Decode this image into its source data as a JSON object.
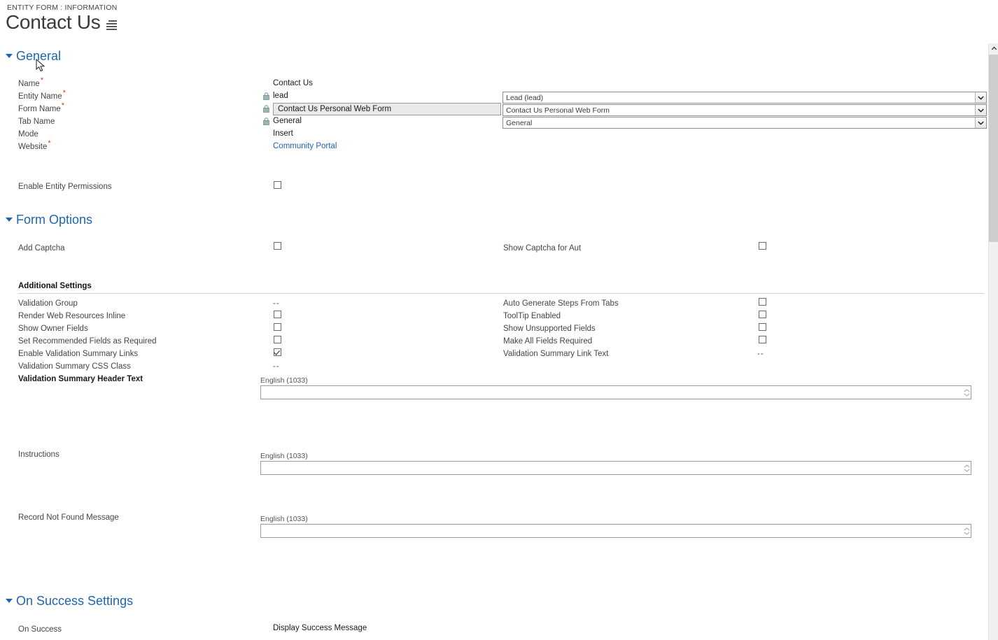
{
  "header": {
    "eyebrow": "ENTITY FORM : INFORMATION",
    "title": "Contact Us",
    "menu_icon": "list-lines-icon"
  },
  "sections": {
    "general": {
      "label": "General"
    },
    "form_options": {
      "label": "Form Options"
    },
    "on_success": {
      "label": "On Success Settings"
    }
  },
  "general": {
    "fields": [
      {
        "label": "Name",
        "required": true,
        "value": "Contact Us",
        "locked": false
      },
      {
        "label": "Entity Name",
        "required": true,
        "value": "lead",
        "locked": true
      },
      {
        "label": "Form Name",
        "required": true,
        "value": "Contact Us Personal Web Form",
        "locked": true
      },
      {
        "label": "Tab Name",
        "required": false,
        "value": "General",
        "locked": true
      },
      {
        "label": "Mode",
        "required": false,
        "value": "Insert",
        "locked": false
      },
      {
        "label": "Website",
        "required": true,
        "value": "Community Portal",
        "locked": false
      }
    ],
    "selects": [
      {
        "name": "entity-name-select",
        "value": "Lead (lead)"
      },
      {
        "name": "form-name-select",
        "value": "Contact Us Personal Web Form"
      },
      {
        "name": "tab-name-select",
        "value": "General"
      }
    ],
    "enable_entity_permissions": {
      "label": "Enable Entity Permissions",
      "checked": false
    }
  },
  "form_options": {
    "add_captcha": {
      "label": "Add Captcha",
      "checked": false
    },
    "show_captcha_auth": {
      "label": "Show Captcha for Aut",
      "checked": false
    },
    "additional_settings_label": "Additional Settings",
    "left_rows": [
      {
        "label": "Validation Group",
        "type": "text",
        "value": "--"
      },
      {
        "label": "Render Web Resources Inline",
        "type": "checkbox",
        "checked": false
      },
      {
        "label": "Show Owner Fields",
        "type": "checkbox",
        "checked": false
      },
      {
        "label": "Set Recommended Fields as Required",
        "type": "checkbox",
        "checked": false
      },
      {
        "label": "Enable Validation Summary Links",
        "type": "checkbox",
        "checked": true
      },
      {
        "label": "Validation Summary CSS Class",
        "type": "text",
        "value": "--"
      }
    ],
    "right_rows": [
      {
        "label": "Auto Generate Steps From Tabs",
        "type": "checkbox",
        "checked": false
      },
      {
        "label": "ToolTip Enabled",
        "type": "checkbox",
        "checked": false
      },
      {
        "label": "Show Unsupported Fields",
        "type": "checkbox",
        "checked": false
      },
      {
        "label": "Make All Fields Required",
        "type": "checkbox",
        "checked": false
      },
      {
        "label": "Validation Summary Link Text",
        "type": "text",
        "value": "--"
      }
    ],
    "localized_blocks": [
      {
        "label": "Validation Summary Header Text",
        "lang": "English (1033)",
        "value": "",
        "bold": true
      },
      {
        "label": "Instructions",
        "lang": "English (1033)",
        "value": "",
        "bold": false
      },
      {
        "label": "Record Not Found Message",
        "lang": "English (1033)",
        "value": "",
        "bold": false
      }
    ]
  },
  "on_success": {
    "label": "On Success",
    "value": "Display Success Message"
  },
  "colors": {
    "accent": "#1f64ae",
    "required": "#d83b01",
    "link": "#1f64ae",
    "label": "#444444",
    "scrollbar_thumb": "#cdcdcd"
  }
}
